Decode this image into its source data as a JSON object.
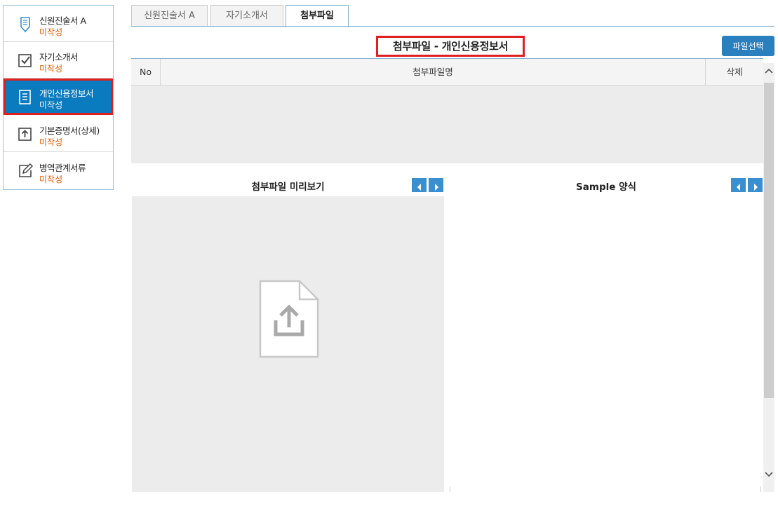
{
  "sidebar": {
    "items": [
      {
        "label": "신원진술서 A",
        "status": "미작성",
        "icon": "pencil-clipboard-icon"
      },
      {
        "label": "자기소개서",
        "status": "미작성",
        "icon": "checkbox-icon"
      },
      {
        "label": "개인신용정보서",
        "status": "미작성",
        "icon": "document-icon",
        "active": true
      },
      {
        "label": "기본증명서(상세)",
        "status": "미작성",
        "icon": "upload-box-icon"
      },
      {
        "label": "병역관계서류",
        "status": "미작성",
        "icon": "edit-icon"
      }
    ]
  },
  "tabs": [
    {
      "label": "신원진술서 A"
    },
    {
      "label": "자기소개서"
    },
    {
      "label": "첨부파일",
      "active": true
    }
  ],
  "main": {
    "title": "첨부파일 - 개인신용정보서",
    "file_select_label": "파일선택",
    "table": {
      "columns": [
        "No",
        "첨부파일명",
        "삭제"
      ],
      "rows": []
    },
    "preview_title": "첨부파일 미리보기",
    "sample_title": "Sample 양식"
  },
  "colors": {
    "accent": "#0b7bc0",
    "highlight_border": "#e01f1f",
    "status_text": "#e25a00",
    "button": "#2a7fbf"
  }
}
